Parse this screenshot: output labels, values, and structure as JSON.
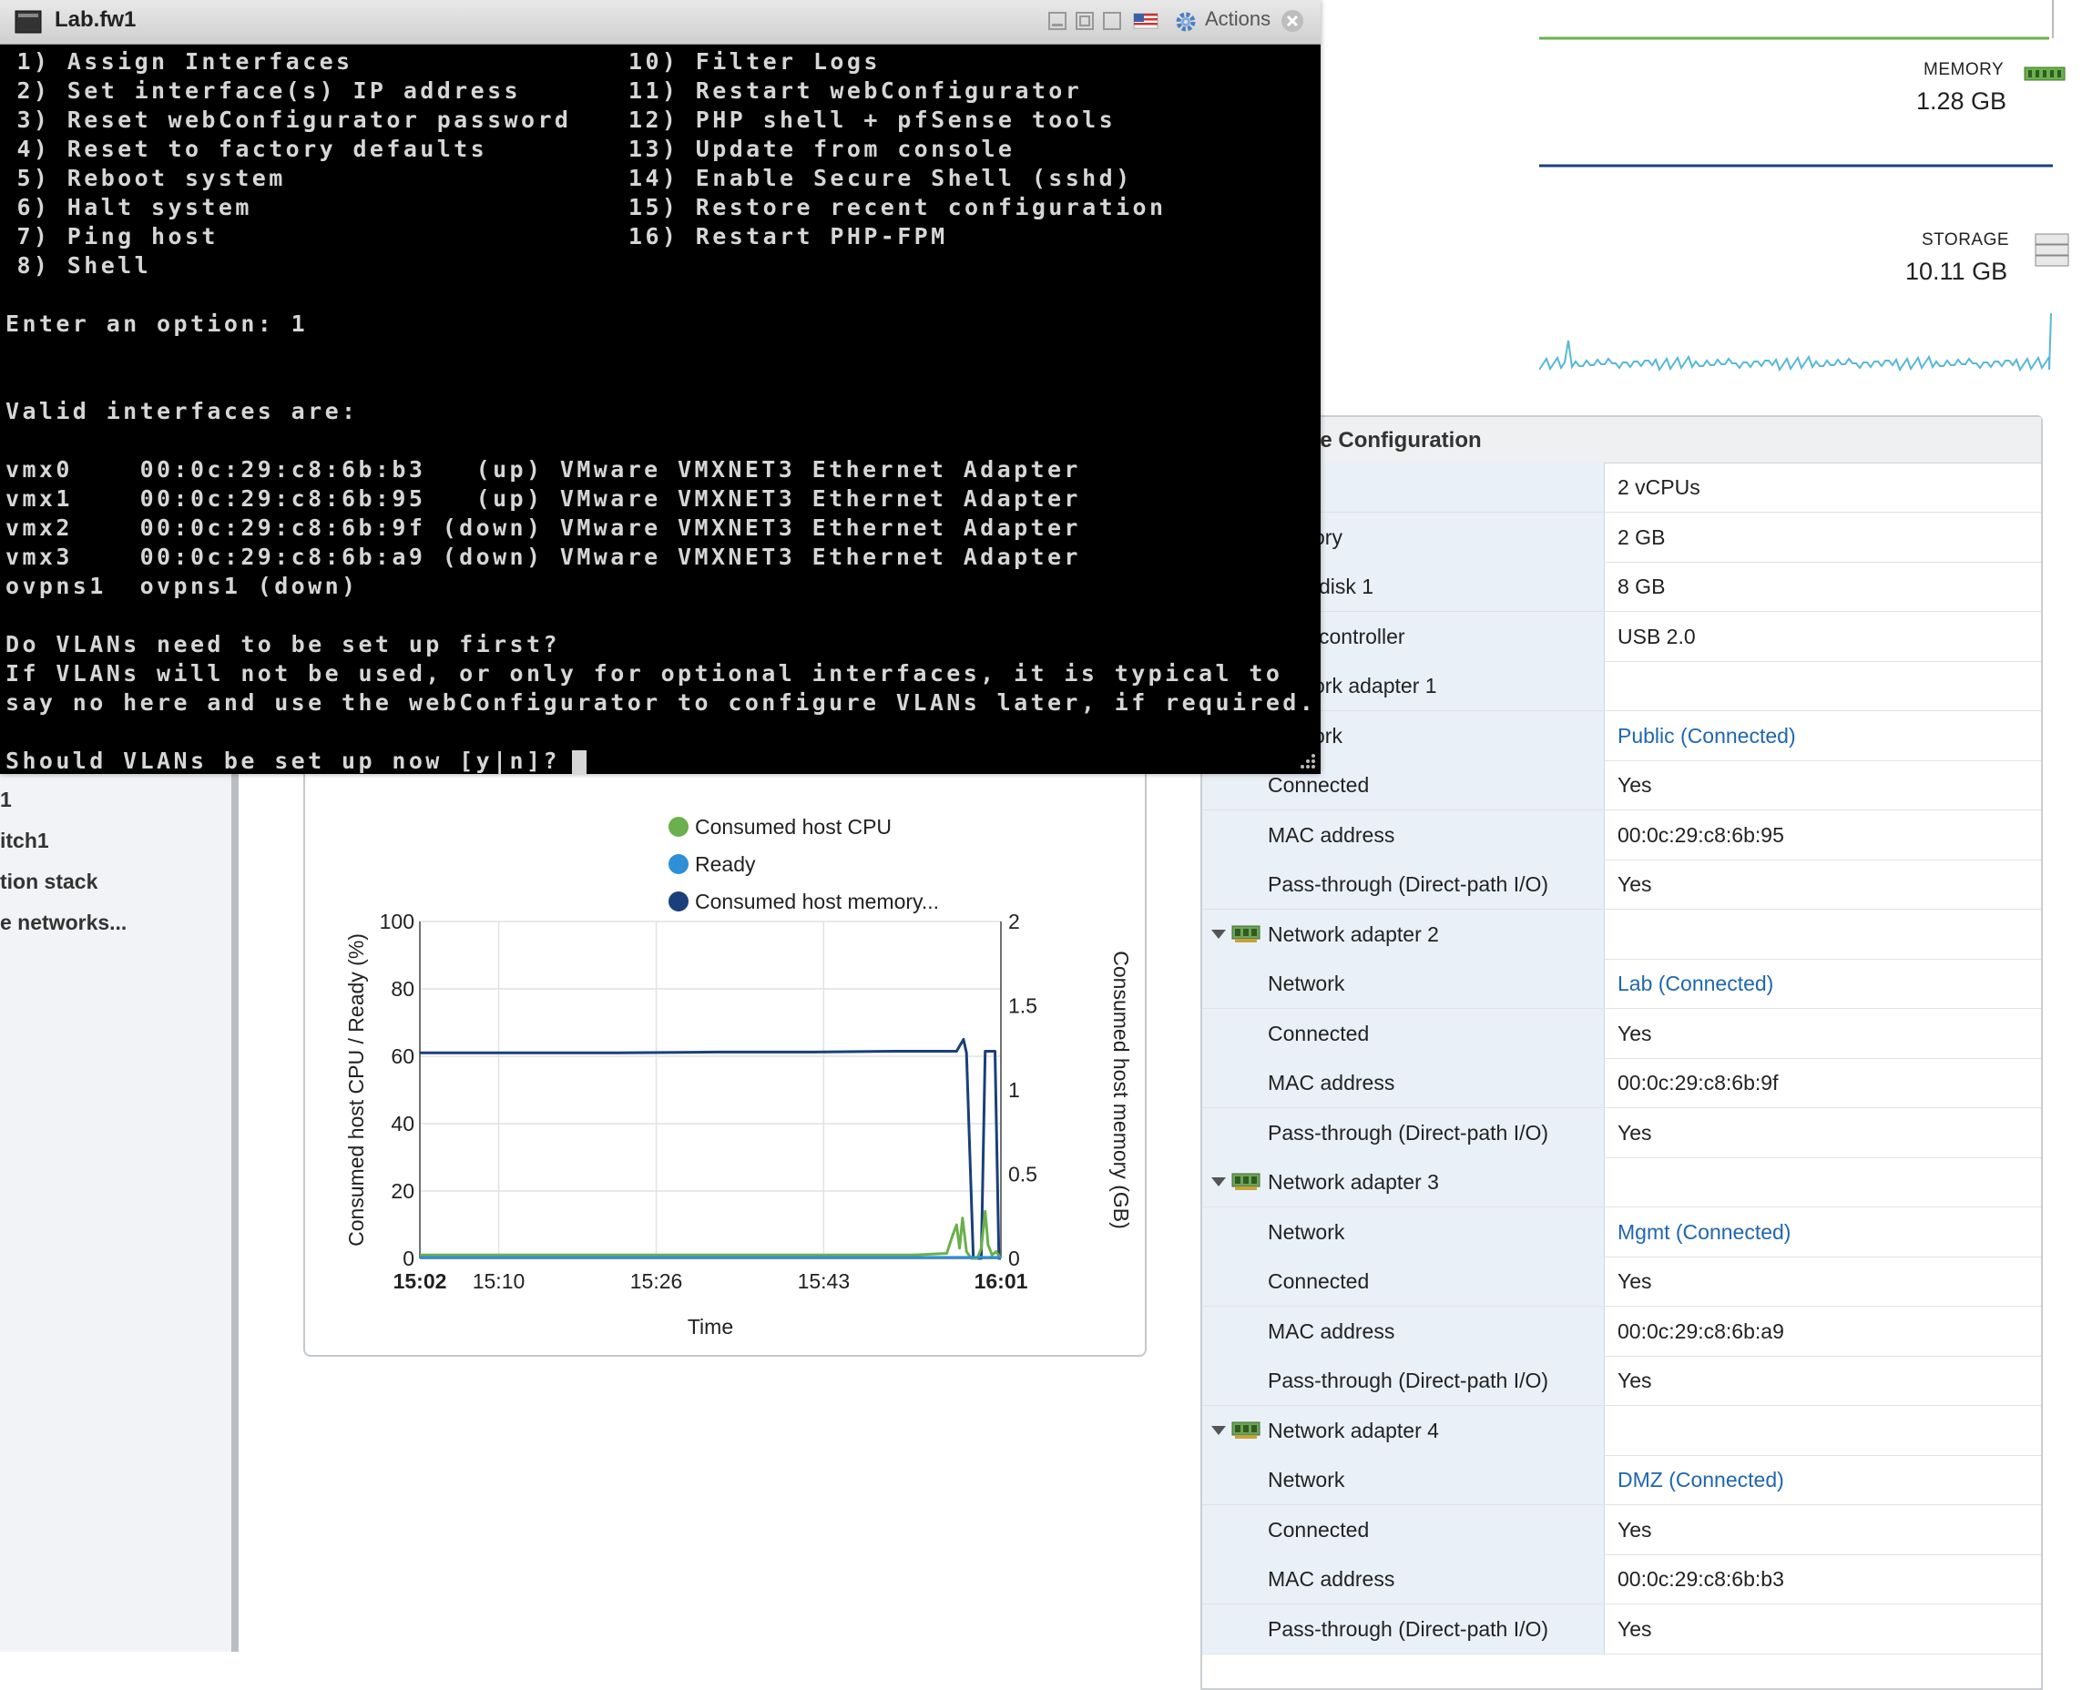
{
  "console": {
    "window_title": "Lab.fw1",
    "actions_label": "Actions",
    "menu_left": [
      " 1) Assign Interfaces",
      " 2) Set interface(s) IP address",
      " 3) Reset webConfigurator password",
      " 4) Reset to factory defaults",
      " 5) Reboot system",
      " 6) Halt system",
      " 7) Ping host",
      " 8) Shell"
    ],
    "menu_right": [
      "10) Filter Logs",
      "11) Restart webConfigurator",
      "12) PHP shell + pfSense tools",
      "13) Update from console",
      "14) Enable Secure Shell (sshd)",
      "15) Restore recent configuration",
      "16) Restart PHP-FPM"
    ],
    "prompt_option": "Enter an option: 1",
    "valid_header": "Valid interfaces are:",
    "interfaces": [
      "vmx0    00:0c:29:c8:6b:b3   (up) VMware VMXNET3 Ethernet Adapter",
      "vmx1    00:0c:29:c8:6b:95   (up) VMware VMXNET3 Ethernet Adapter",
      "vmx2    00:0c:29:c8:6b:9f (down) VMware VMXNET3 Ethernet Adapter",
      "vmx3    00:0c:29:c8:6b:a9 (down) VMware VMXNET3 Ethernet Adapter",
      "ovpns1  ovpns1 (down)"
    ],
    "vlan_q1": "Do VLANs need to be set up first?",
    "vlan_q2": "If VLANs will not be used, or only for optional interfaces, it is typical to",
    "vlan_q3": "say no here and use the webConfigurator to configure VLANs later, if required.",
    "vlan_prompt": "Should VLANs be set up now [y|n]? "
  },
  "meters": {
    "memory_label": "MEMORY",
    "memory_value": "1.28 GB",
    "storage_label": "STORAGE",
    "storage_value": "10.11 GB"
  },
  "sidebar": {
    "items": [
      "1",
      "itch1",
      "tion stack",
      "e networks..."
    ]
  },
  "hardware": {
    "title": "re Configuration",
    "rows": [
      {
        "label": "",
        "value": "2 vCPUs"
      },
      {
        "label": "ory",
        "value": "2 GB"
      },
      {
        "label": "disk 1",
        "value": "8 GB"
      },
      {
        "label": "controller",
        "value": "USB 2.0"
      },
      {
        "label": "ork adapter 1",
        "value": ""
      },
      {
        "label": "ork",
        "value": "Public (Connected)",
        "link": true
      },
      {
        "label": "Connected",
        "value": "Yes"
      },
      {
        "label": "MAC address",
        "value": "00:0c:29:c8:6b:95"
      },
      {
        "label": "Pass-through (Direct-path I/O)",
        "value": "Yes"
      },
      {
        "label": "Network adapter 2",
        "value": "",
        "group": true
      },
      {
        "label": "Network",
        "value": "Lab (Connected)",
        "link": true
      },
      {
        "label": "Connected",
        "value": "Yes"
      },
      {
        "label": "MAC address",
        "value": "00:0c:29:c8:6b:9f"
      },
      {
        "label": "Pass-through (Direct-path I/O)",
        "value": "Yes"
      },
      {
        "label": "Network adapter 3",
        "value": "",
        "group": true
      },
      {
        "label": "Network",
        "value": "Mgmt (Connected)",
        "link": true
      },
      {
        "label": "Connected",
        "value": "Yes"
      },
      {
        "label": "MAC address",
        "value": "00:0c:29:c8:6b:a9"
      },
      {
        "label": "Pass-through (Direct-path I/O)",
        "value": "Yes"
      },
      {
        "label": "Network adapter 4",
        "value": "",
        "group": true
      },
      {
        "label": "Network",
        "value": "DMZ (Connected)",
        "link": true
      },
      {
        "label": "Connected",
        "value": "Yes"
      },
      {
        "label": "MAC address",
        "value": "00:0c:29:c8:6b:b3"
      },
      {
        "label": "Pass-through (Direct-path I/O)",
        "value": "Yes"
      }
    ]
  },
  "colors": {
    "cpu": "#6ab04c",
    "ready": "#2e8fd6",
    "memory": "#1b3f7a",
    "link": "#1f66b0"
  },
  "chart_data": {
    "type": "line",
    "legend": [
      "Consumed host CPU",
      "Ready",
      "Consumed host memory..."
    ],
    "xlabel": "Time",
    "ylabel_left": "Consumed host CPU / Ready (%)",
    "ylabel_right": "Consumed host memory (GB)",
    "x_ticks": [
      "15:02",
      "15:10",
      "15:26",
      "15:43",
      "16:01"
    ],
    "y_left_ticks": [
      "0",
      "20",
      "40",
      "60",
      "80",
      "100"
    ],
    "y_right_ticks": [
      "0",
      "0.5",
      "1",
      "1.5",
      "2"
    ],
    "ylim_left": [
      0,
      100
    ],
    "ylim_right": [
      0,
      2
    ],
    "x_minutes": [
      0,
      59
    ],
    "series": [
      {
        "name": "Consumed host memory...",
        "axis": "right",
        "x": [
          0,
          10,
          20,
          30,
          40,
          48,
          54.5,
          55.2,
          55.5,
          56.2,
          56.6,
          57.0,
          57.4,
          58.4,
          58.8,
          59
        ],
        "y": [
          1.22,
          1.22,
          1.22,
          1.225,
          1.225,
          1.23,
          1.23,
          1.3,
          1.22,
          0,
          0,
          0,
          1.23,
          1.23,
          0,
          0
        ]
      },
      {
        "name": "Consumed host CPU",
        "axis": "left",
        "x": [
          0,
          10,
          20,
          30,
          40,
          50,
          53.5,
          54.0,
          54.5,
          54.8,
          55.1,
          55.5,
          56.0,
          56.6,
          57.0,
          57.4,
          57.7,
          58.1,
          58.5,
          59
        ],
        "y": [
          1,
          1,
          1,
          1,
          1,
          1,
          1.5,
          6,
          10,
          3,
          12,
          2,
          0,
          0,
          3,
          14,
          4,
          1,
          2,
          0
        ]
      },
      {
        "name": "Ready",
        "axis": "left",
        "x": [
          0,
          59
        ],
        "y": [
          0.3,
          0.3
        ]
      }
    ]
  }
}
